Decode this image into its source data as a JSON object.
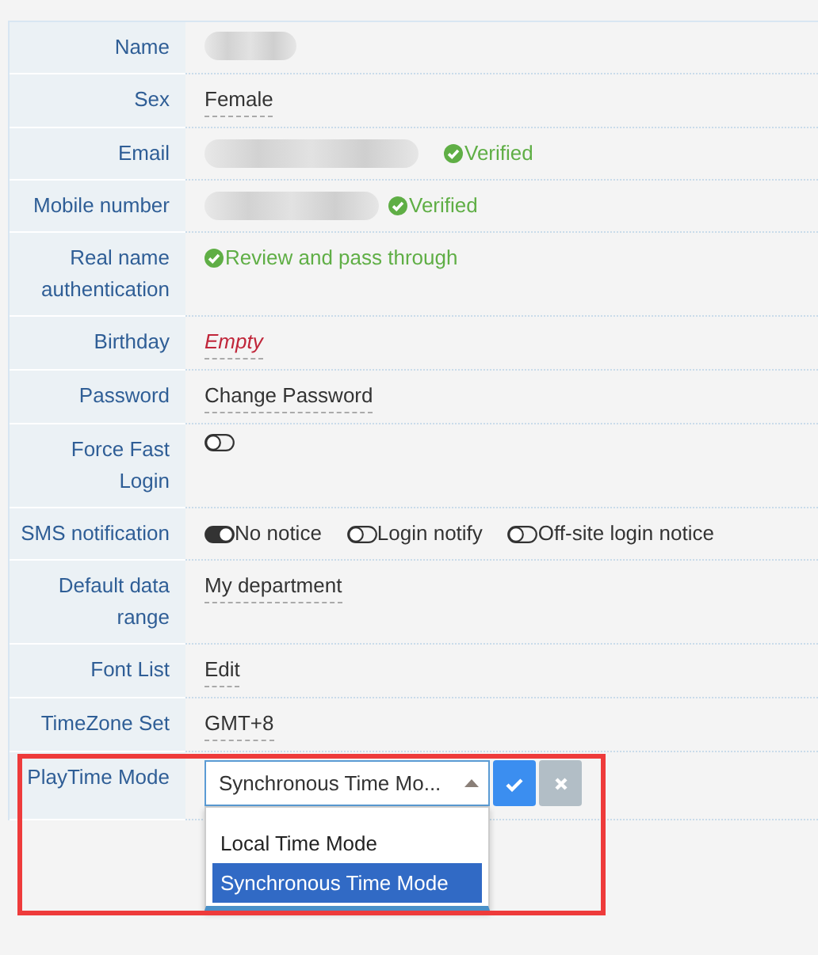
{
  "rows": [
    {
      "label": "Name",
      "kind": "redacted"
    },
    {
      "label": "Sex",
      "kind": "editable",
      "value": "Female",
      "empty": false
    },
    {
      "label": "Email",
      "kind": "redacted",
      "verified": "Verified"
    },
    {
      "label": "Mobile number",
      "kind": "redacted",
      "verified": "Verified"
    },
    {
      "label": "Real name authentication",
      "kind": "status",
      "status": "Review and pass through"
    },
    {
      "label": "Birthday",
      "kind": "editable",
      "value": "Empty",
      "empty": true
    },
    {
      "label": "Password",
      "kind": "editable",
      "value": "Change Password",
      "empty": false
    },
    {
      "label": "Force Fast Login",
      "kind": "toggles",
      "toggles": [
        {
          "on": false
        }
      ]
    },
    {
      "label": "SMS notification",
      "kind": "toggles",
      "toggles": [
        {
          "label": "No notice",
          "on": true
        },
        {
          "label": "Login notify",
          "on": false
        },
        {
          "label": "Off-site login notice",
          "on": false
        }
      ]
    },
    {
      "label": "Default data range",
      "kind": "editable",
      "value": "My department",
      "empty": false
    },
    {
      "label": "Font List",
      "kind": "editable",
      "value": "Edit",
      "empty": false
    },
    {
      "label": "TimeZone Set",
      "kind": "editable",
      "value": "GMT+8",
      "empty": false
    },
    {
      "label": "PlayTime Mode",
      "kind": "select",
      "highlighted": true,
      "value": "Synchronous Time Mo...",
      "expanded": true,
      "options": [
        {
          "label": "Local Time Mode",
          "selected": false
        },
        {
          "label": "Synchronous Time Mode",
          "selected": true
        }
      ]
    }
  ]
}
